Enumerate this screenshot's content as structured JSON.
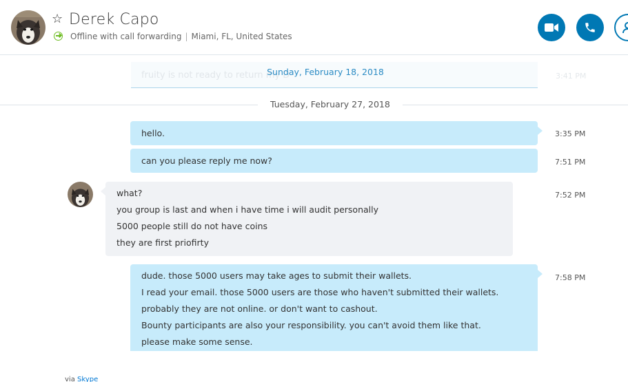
{
  "header": {
    "contact_name": "Derek Capo",
    "star_glyph": "☆",
    "status": "Offline with call forwarding",
    "separator": "|",
    "location": "Miami, FL, United States",
    "accent_color": "#0078b4"
  },
  "conversation": {
    "faded_message": "fruity is not ready to return my D",
    "faded_time": "3:41 PM",
    "sticky_date": "Sunday, February 18, 2018",
    "date_divider": "Tuesday, February 27, 2018",
    "messages": [
      {
        "direction": "outgoing",
        "lines": [
          "hello."
        ],
        "time": "3:35 PM"
      },
      {
        "direction": "outgoing",
        "lines": [
          "can you please reply me now?"
        ],
        "time": "7:51 PM"
      },
      {
        "direction": "incoming",
        "lines": [
          "what?",
          "you group is last and when i have time i will audit personally",
          "5000 people still do not have coins",
          "they are first priofirty"
        ],
        "time": "7:52 PM"
      },
      {
        "direction": "outgoing",
        "lines": [
          "dude. those 5000 users may take ages to submit their wallets.",
          "I read your email. those 5000 users are those who haven't submitted their wallets.",
          "probably they are not online. or don't want to cashout.",
          "Bounty participants are also your responsibility. you can't avoid them like that.",
          "please make some sense."
        ],
        "time": "7:58 PM"
      }
    ],
    "via_prefix": "via",
    "via_link": "Skype"
  }
}
